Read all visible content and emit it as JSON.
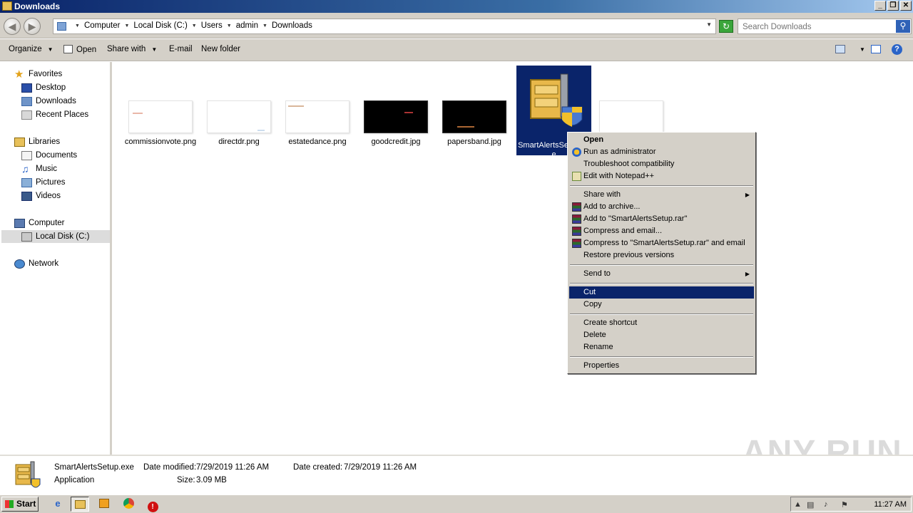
{
  "window": {
    "title": "Downloads",
    "controls": [
      "_",
      "❐",
      "✕"
    ]
  },
  "address": {
    "breadcrumbs": [
      "Computer",
      "Local Disk (C:)",
      "Users",
      "admin",
      "Downloads"
    ],
    "search_placeholder": "Search Downloads"
  },
  "toolbar": {
    "organize": "Organize",
    "open": "Open",
    "share_with": "Share with",
    "email": "E-mail",
    "new_folder": "New folder"
  },
  "nav": {
    "favorites": "Favorites",
    "desktop": "Desktop",
    "downloads": "Downloads",
    "recent_places": "Recent Places",
    "libraries": "Libraries",
    "documents": "Documents",
    "music": "Music",
    "pictures": "Pictures",
    "videos": "Videos",
    "computer": "Computer",
    "local_disk": "Local Disk (C:)",
    "network": "Network"
  },
  "files": [
    {
      "name": "commissionvote.png",
      "thumb": "light"
    },
    {
      "name": "directdr.png",
      "thumb": "light"
    },
    {
      "name": "estatedance.png",
      "thumb": "light"
    },
    {
      "name": "goodcredit.jpg",
      "thumb": "dark"
    },
    {
      "name": "papersband.jpg",
      "thumb": "dark"
    },
    {
      "name": "SmartAlertsSetup.exe",
      "thumb": "exe",
      "selected": true
    },
    {
      "name": "",
      "thumb": "light"
    }
  ],
  "context_menu": {
    "open": "Open",
    "run_as_admin": "Run as administrator",
    "troubleshoot": "Troubleshoot compatibility",
    "notepadpp": "Edit with Notepad++",
    "share_with": "Share with",
    "add_archive": "Add to archive...",
    "add_rar": "Add to \"SmartAlertsSetup.rar\"",
    "compress_email": "Compress and email...",
    "compress_rar_email": "Compress to \"SmartAlertsSetup.rar\" and email",
    "restore": "Restore previous versions",
    "send_to": "Send to",
    "cut": "Cut",
    "copy": "Copy",
    "create_shortcut": "Create shortcut",
    "delete": "Delete",
    "rename": "Rename",
    "properties": "Properties"
  },
  "details": {
    "filename": "SmartAlertsSetup.exe",
    "type": "Application",
    "date_modified_label": "Date modified:",
    "date_modified": "7/29/2019 11:26 AM",
    "date_created_label": "Date created:",
    "date_created": "7/29/2019 11:26 AM",
    "size_label": "Size:",
    "size": "3.09 MB"
  },
  "watermark": "ANY RUN",
  "taskbar": {
    "start": "Start",
    "clock": "11:27 AM"
  },
  "colors": {
    "selection": "#0a246a",
    "chrome": "#d4d0c8"
  }
}
